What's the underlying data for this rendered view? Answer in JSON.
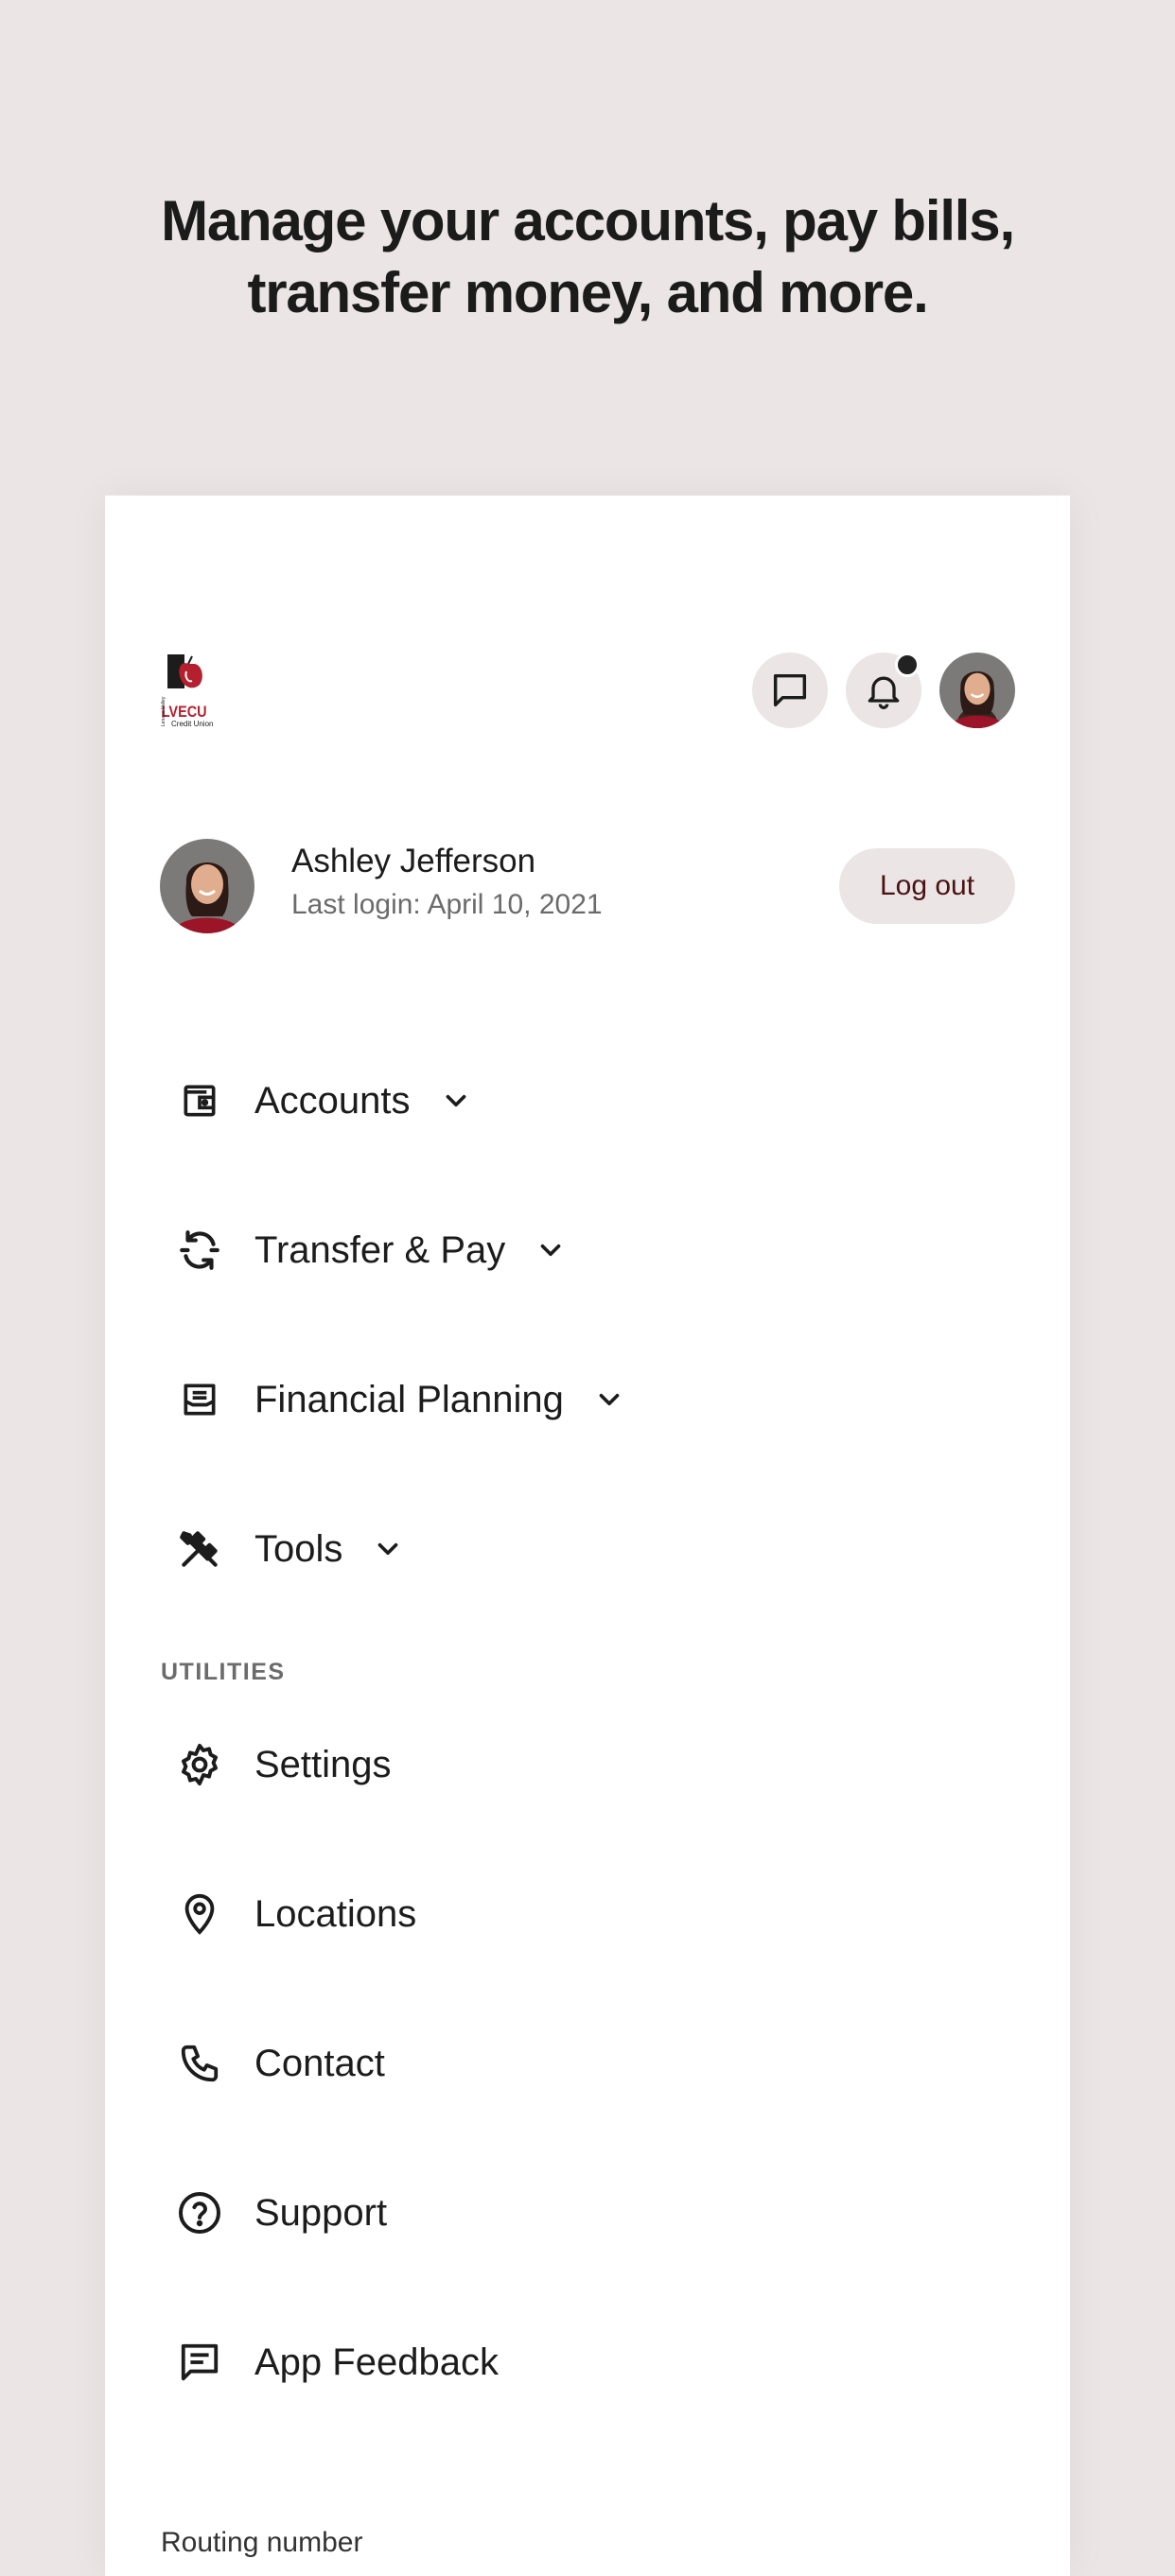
{
  "headline": {
    "line1": "Manage your accounts, pay bills,",
    "line2": "transfer money, and more."
  },
  "header": {
    "logo_text": "LVECU",
    "logo_subtext": "Credit Union",
    "logo_vertical_text": "Lenape Valley",
    "icons": [
      "chat-bubble-icon",
      "bell-icon",
      "avatar"
    ],
    "has_notification": true
  },
  "profile": {
    "name": "Ashley Jefferson",
    "last_login": "Last login: April 10, 2021",
    "logout_label": "Log out"
  },
  "menu": {
    "items": [
      {
        "label": "Accounts",
        "icon": "wallet-icon",
        "expandable": true
      },
      {
        "label": "Transfer & Pay",
        "icon": "sync-icon",
        "expandable": true
      },
      {
        "label": "Financial Planning",
        "icon": "planner-icon",
        "expandable": true
      },
      {
        "label": "Tools",
        "icon": "tools-icon",
        "expandable": true
      }
    ]
  },
  "utilities": {
    "section_label": "UTILITIES",
    "items": [
      {
        "label": "Settings",
        "icon": "gear-icon"
      },
      {
        "label": "Locations",
        "icon": "map-pin-icon"
      },
      {
        "label": "Contact",
        "icon": "phone-icon"
      },
      {
        "label": "Support",
        "icon": "help-circle-icon"
      },
      {
        "label": "App Feedback",
        "icon": "feedback-icon"
      }
    ]
  },
  "footer": {
    "routing_label": "Routing number"
  },
  "colors": {
    "background": "#ebe5e5",
    "card": "#ffffff",
    "text": "#1c1c1c",
    "muted": "#6b6b6b",
    "logout_text": "#4a1212",
    "brand_red": "#b5202e"
  }
}
